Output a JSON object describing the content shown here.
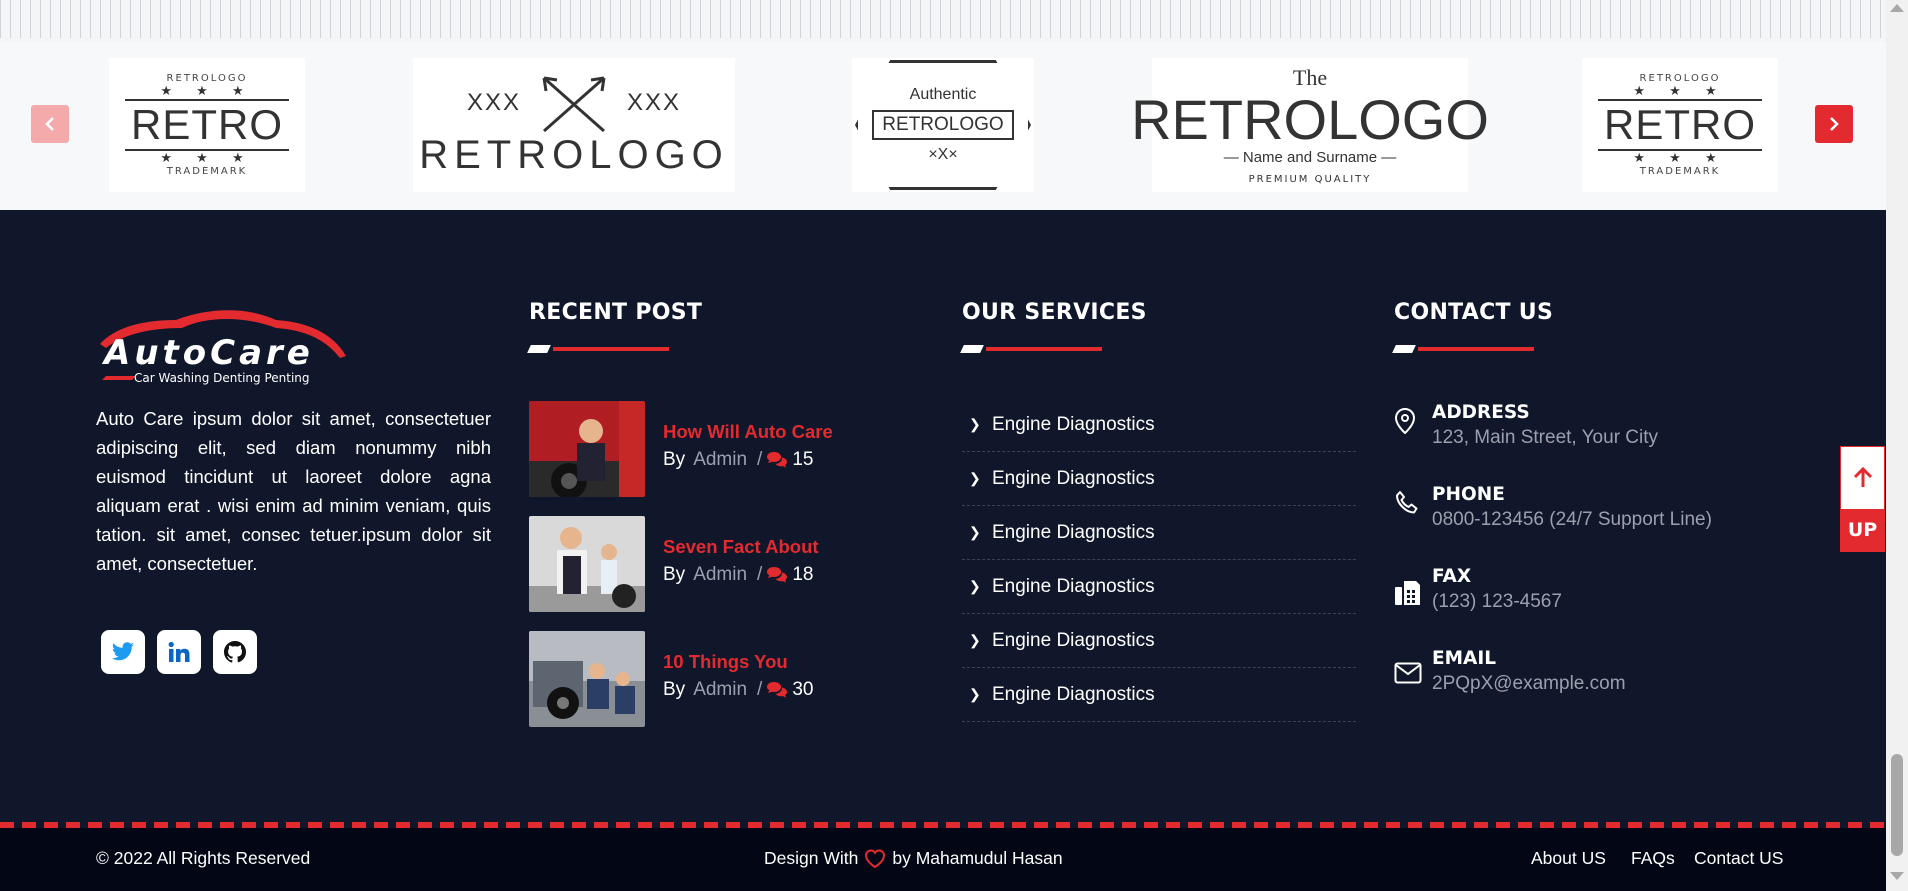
{
  "carousel": {
    "prev_icon": "chevron-left-icon",
    "next_icon": "chevron-right-icon",
    "logos": [
      {
        "top": "RETROLOGO",
        "main": "RETRO",
        "bottom": "TRADEMARK"
      },
      {
        "left": "XXX",
        "right": "XXX",
        "main": "RETROLOGO"
      },
      {
        "top": "Authentic",
        "main": "RETROLOGO",
        "bottom": "×X×"
      },
      {
        "top": "The",
        "main": "RETROLOGO",
        "sub": "— Name and Surname —",
        "bottom": "PREMIUM QUALITY"
      },
      {
        "top": "RETROLOGO",
        "main": "RETRO",
        "bottom": "TRADEMARK"
      }
    ]
  },
  "brand": {
    "name": "AutoCare",
    "tagline": "Car Washing Denting Penting",
    "about": "Auto Care ipsum dolor sit amet, consectetuer adipiscing elit, sed diam nonummy nibh euismod tincidunt ut laoreet dolore agna aliquam erat . wisi enim ad minim veniam, quis tation. sit amet, consec tetuer.ipsum dolor sit amet, consectetuer."
  },
  "socials": [
    {
      "icon": "twitter-icon"
    },
    {
      "icon": "linkedin-icon"
    },
    {
      "icon": "github-icon"
    }
  ],
  "recent": {
    "heading": "RECENT POST",
    "posts": [
      {
        "title": "How Will Auto Care",
        "by": "By",
        "author": "Admin",
        "sep": "/",
        "comments": "15"
      },
      {
        "title": "Seven Fact About",
        "by": "By",
        "author": "Admin",
        "sep": "/",
        "comments": "18"
      },
      {
        "title": "10 Things You",
        "by": "By",
        "author": "Admin",
        "sep": "/",
        "comments": "30"
      }
    ]
  },
  "services": {
    "heading": "OUR SERVICES",
    "items": [
      "Engine Diagnostics",
      "Engine Diagnostics",
      "Engine Diagnostics",
      "Engine Diagnostics",
      "Engine Diagnostics",
      "Engine Diagnostics"
    ]
  },
  "contact": {
    "heading": "CONTACT US",
    "items": [
      {
        "label": "ADDRESS",
        "value": "123, Main Street, Your City",
        "icon": "map-pin-icon"
      },
      {
        "label": "PHONE",
        "value": "0800-123456 (24/7 Support Line)",
        "icon": "phone-icon"
      },
      {
        "label": "FAX",
        "value": "(123) 123-4567",
        "icon": "fax-icon"
      },
      {
        "label": "EMAIL",
        "value": "2PQpX@example.com",
        "icon": "envelope-icon"
      }
    ]
  },
  "scroll_up": {
    "label": "UP",
    "icon": "arrow-up-icon"
  },
  "bottom": {
    "copyright": "© 2022 All Rights Reserved",
    "design_with": "Design With",
    "by_author": "by Mahamudul Hasan",
    "links": [
      "About US",
      "FAQs",
      "Contact US"
    ]
  },
  "colors": {
    "accent": "#e32a2f",
    "footer_bg": "#10172a",
    "bottom_bg": "#020615",
    "muted": "#9aa0ad"
  }
}
